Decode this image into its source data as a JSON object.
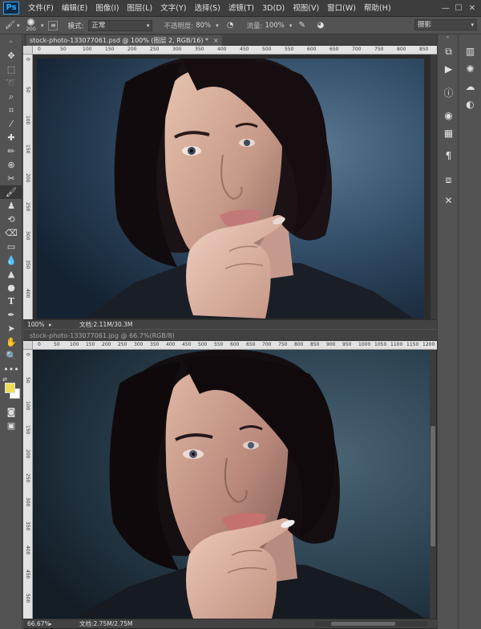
{
  "app": {
    "logo": "Ps"
  },
  "menu": [
    "文件(F)",
    "编辑(E)",
    "图像(I)",
    "图层(L)",
    "文字(Y)",
    "选择(S)",
    "滤镜(T)",
    "3D(D)",
    "视图(V)",
    "窗口(W)",
    "帮助(H)"
  ],
  "window_controls": {
    "minimize": "—",
    "maximize": "☐",
    "close": "✕"
  },
  "options": {
    "brush_size": "200",
    "mode_label": "模式:",
    "mode_value": "正常",
    "opacity_label": "不透明度:",
    "opacity_value": "80%",
    "flow_label": "流量:",
    "flow_value": "100%",
    "workspace": "摄影"
  },
  "doc1": {
    "tab": "stock-photo-133077061.psd @ 100% (图层 2, RGB/16) *",
    "close": "×",
    "zoom": "100%",
    "info": "文档:2.11M/30.3M",
    "ruler_ticks": [
      "0",
      "50",
      "100",
      "150",
      "200",
      "250",
      "300",
      "350",
      "400",
      "450",
      "500",
      "550",
      "600",
      "650",
      "700",
      "750",
      "800",
      "850"
    ],
    "vruler_ticks": [
      "0",
      "50",
      "100",
      "150",
      "200",
      "250",
      "300",
      "350",
      "400"
    ]
  },
  "doc2": {
    "tab": "stock-photo-133077061.jpg @ 66.7%(RGB/8)",
    "zoom": "66.67%",
    "info": "文档:2.75M/2.75M",
    "ruler_ticks": [
      "0",
      "50",
      "100",
      "150",
      "200",
      "250",
      "300",
      "350",
      "400",
      "450",
      "500",
      "550",
      "600",
      "650",
      "700",
      "750",
      "800",
      "850",
      "900",
      "950",
      "1000",
      "1050",
      "1100",
      "1150",
      "1200"
    ],
    "vruler_ticks": [
      "0",
      "50",
      "100",
      "150",
      "200",
      "250",
      "300",
      "350",
      "400",
      "450",
      "500"
    ]
  },
  "colors": {
    "foreground": "#f0dc5a",
    "background": "#ffffff",
    "accent": "#31a8ff"
  },
  "tools": [
    "move-icon",
    "marquee-icon",
    "lasso-icon",
    "quick-select-icon",
    "crop-icon",
    "eyedropper-icon",
    "healing-icon",
    "brush-icon",
    "clone-stamp-icon",
    "history-brush-icon",
    "eraser-icon",
    "gradient-icon",
    "blur-icon",
    "dodge-icon",
    "pen-icon",
    "type-icon",
    "path-select-icon",
    "shape-icon",
    "hand-icon",
    "zoom-icon",
    "more-tools-icon"
  ],
  "dock_icons": [
    "history-icon",
    "actions-icon",
    "info-icon",
    "color-icon",
    "swatches-icon",
    "character-icon",
    "paragraph-icon",
    "tool-presets-icon"
  ],
  "dock2_icons": [
    "layers-icon",
    "adjustments-icon",
    "libraries-icon",
    "styles-icon"
  ]
}
